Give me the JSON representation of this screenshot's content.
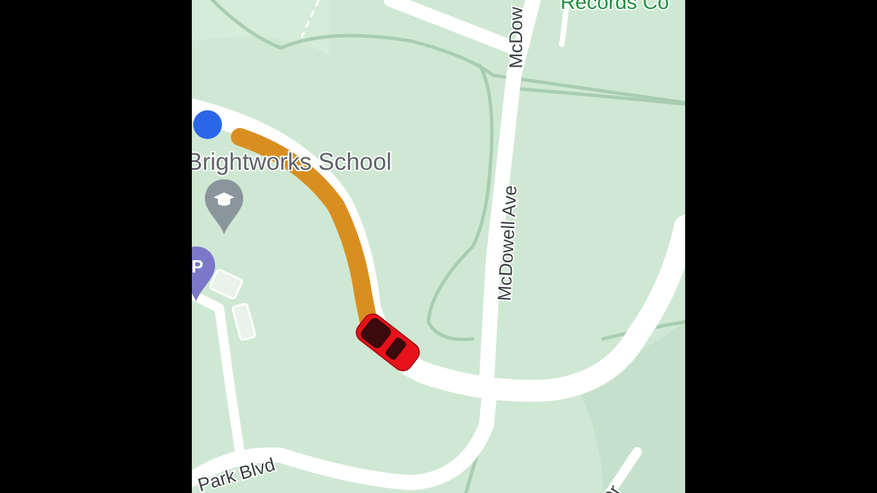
{
  "map": {
    "places": {
      "school": "Brightworks School",
      "records": "Records Co"
    },
    "roads": {
      "mcdowell_top": "McDow",
      "mcdowell": "McDowell Ave",
      "park_blvd": "Park Blvd",
      "bottom_right": "Dr"
    },
    "icons": {
      "school_pin": "graduation-cap-icon",
      "parking_pin": "parking-icon",
      "vehicle": "car-icon",
      "current_location": "location-dot-icon"
    },
    "route": {
      "traveled_color": "#d98f20",
      "vehicle_color": "#e8121a",
      "location_color": "#2a67e8"
    },
    "colors": {
      "land": "#cfe8d3",
      "road": "#ffffff",
      "place_label_green": "#1e8e3e",
      "pin_gray": "#8a969c",
      "pin_purple": "#7b78c9"
    }
  }
}
